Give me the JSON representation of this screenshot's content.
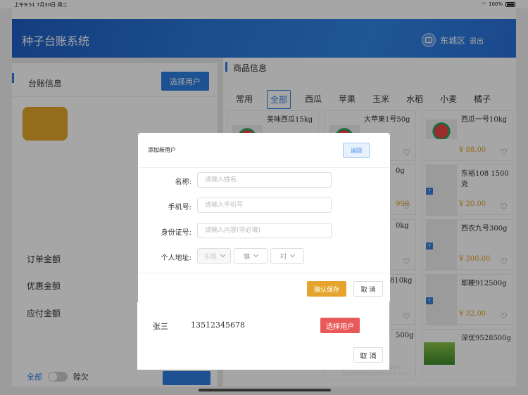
{
  "status": {
    "time_date": "上午9:51  7月30日 周二",
    "battery": "100%"
  },
  "header": {
    "title": "种子台账系统",
    "area": "东城区",
    "logout": "退出"
  },
  "left_panel": {
    "section_title": "台账信息",
    "select_user_button": "选择用户",
    "order_amount_label": "订单金额",
    "discount_amount_label": "优惠金额",
    "payable_amount_label": "应付金额",
    "filter_all": "全部",
    "filter_credit": "赊欠"
  },
  "right_panel": {
    "section_title": "商品信息",
    "categories": [
      "常用",
      "全部",
      "西瓜",
      "苹果",
      "玉米",
      "水稻",
      "小麦",
      "橘子"
    ],
    "active_category": "全部",
    "products": [
      {
        "name": "美味西瓜15kg",
        "price": ""
      },
      {
        "name": "大苹果1号50g",
        "price": ""
      },
      {
        "name": "西瓜一号10kg",
        "price": "¥ 88.00"
      },
      {
        "name": "0g",
        "price": "999"
      },
      {
        "name": "东裕108 1500克",
        "price": "¥ 20.00"
      },
      {
        "name": "0kg",
        "price": ""
      },
      {
        "name": "西农九号300g",
        "price": "¥ 300.00"
      },
      {
        "name": "810kg",
        "price": ""
      },
      {
        "name": "耶粳912500g",
        "price": "¥ 32.00"
      },
      {
        "name": "500g",
        "price": ""
      },
      {
        "name": "深优9528500g",
        "price": ""
      }
    ],
    "footnote_line1": "管理用",
    "footnote_line2": "北京紫峰网络科技有限公司 技术支持"
  },
  "user_list": {
    "rows": [
      {
        "name": "张三",
        "phone": "13512345678",
        "action": "选择用户"
      }
    ],
    "cancel": "取 消"
  },
  "dialog": {
    "title": "添加新用户",
    "back_button": "返回",
    "name_label": "名称:",
    "name_placeholder": "请输入姓名",
    "phone_label": "手机号:",
    "phone_placeholder": "请输入手机号",
    "id_label": "身份证号:",
    "id_placeholder": "请输入内容(非必填)",
    "address_label": "个人地址:",
    "address_selects": [
      "东城",
      "镇",
      "村"
    ],
    "confirm_button": "确认保存",
    "cancel_button": "取 消"
  },
  "colors": {
    "primary": "#2d7fe0",
    "accent": "#e5a52c",
    "danger": "#e85a5a"
  }
}
